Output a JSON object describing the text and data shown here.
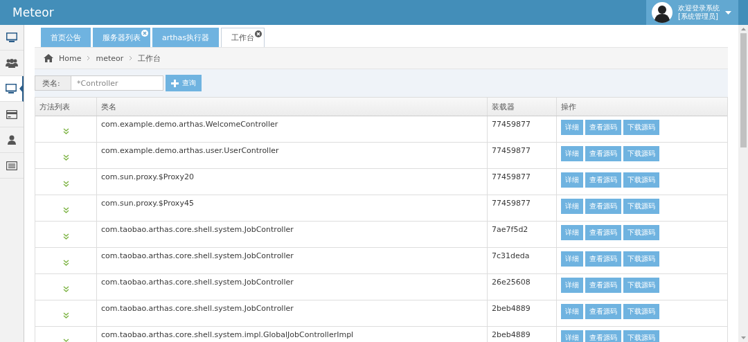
{
  "header": {
    "brand": "Meteor",
    "user": {
      "greeting": "欢迎登录系统",
      "role": "[系统管理员]"
    }
  },
  "sidebar": {
    "items": [
      {
        "kind": "monitor",
        "selected": false
      },
      {
        "kind": "users",
        "selected": false
      },
      {
        "kind": "monitor",
        "selected": true
      },
      {
        "kind": "card",
        "selected": false
      },
      {
        "kind": "user",
        "selected": false
      },
      {
        "kind": "list",
        "selected": false
      }
    ]
  },
  "tabs": [
    {
      "label": "首页公告",
      "selected": false,
      "closable": false
    },
    {
      "label": "服务器列表",
      "selected": false,
      "closable": true
    },
    {
      "label": "arthas执行器",
      "selected": false,
      "closable": false
    },
    {
      "label": "工作台",
      "selected": true,
      "closable": true
    }
  ],
  "breadcrumb": [
    "Home",
    "meteor",
    "工作台"
  ],
  "search": {
    "label": "类名:",
    "value": "*Controller",
    "button": "查询"
  },
  "table": {
    "columns": [
      "方法列表",
      "类名",
      "装载器",
      "操作"
    ],
    "rows": [
      {
        "class_name": "com.example.demo.arthas.WelcomeController",
        "loader": "77459877",
        "actions": [
          "详细",
          "查看源码",
          "下载源码"
        ]
      },
      {
        "class_name": "com.example.demo.arthas.user.UserController",
        "loader": "77459877",
        "actions": [
          "详细",
          "查看源码",
          "下载源码"
        ]
      },
      {
        "class_name": "com.sun.proxy.$Proxy20",
        "loader": "77459877",
        "actions": [
          "详细",
          "查看源码",
          "下载源码"
        ]
      },
      {
        "class_name": "com.sun.proxy.$Proxy45",
        "loader": "77459877",
        "actions": [
          "详细",
          "查看源码",
          "下载源码"
        ]
      },
      {
        "class_name": "com.taobao.arthas.core.shell.system.JobController",
        "loader": "7ae7f5d2",
        "actions": [
          "详细",
          "查看源码",
          "下载源码"
        ]
      },
      {
        "class_name": "com.taobao.arthas.core.shell.system.JobController",
        "loader": "7c31deda",
        "actions": [
          "详细",
          "查看源码",
          "下载源码"
        ]
      },
      {
        "class_name": "com.taobao.arthas.core.shell.system.JobController",
        "loader": "26e25608",
        "actions": [
          "详细",
          "查看源码",
          "下载源码"
        ]
      },
      {
        "class_name": "com.taobao.arthas.core.shell.system.JobController",
        "loader": "2beb4889",
        "actions": [
          "详细",
          "查看源码",
          "下载源码"
        ]
      },
      {
        "class_name": "com.taobao.arthas.core.shell.system.impl.GlobalJobControllerImpl",
        "loader": "2beb4889",
        "actions": [
          "详细",
          "查看源码",
          "下载源码"
        ]
      }
    ]
  }
}
